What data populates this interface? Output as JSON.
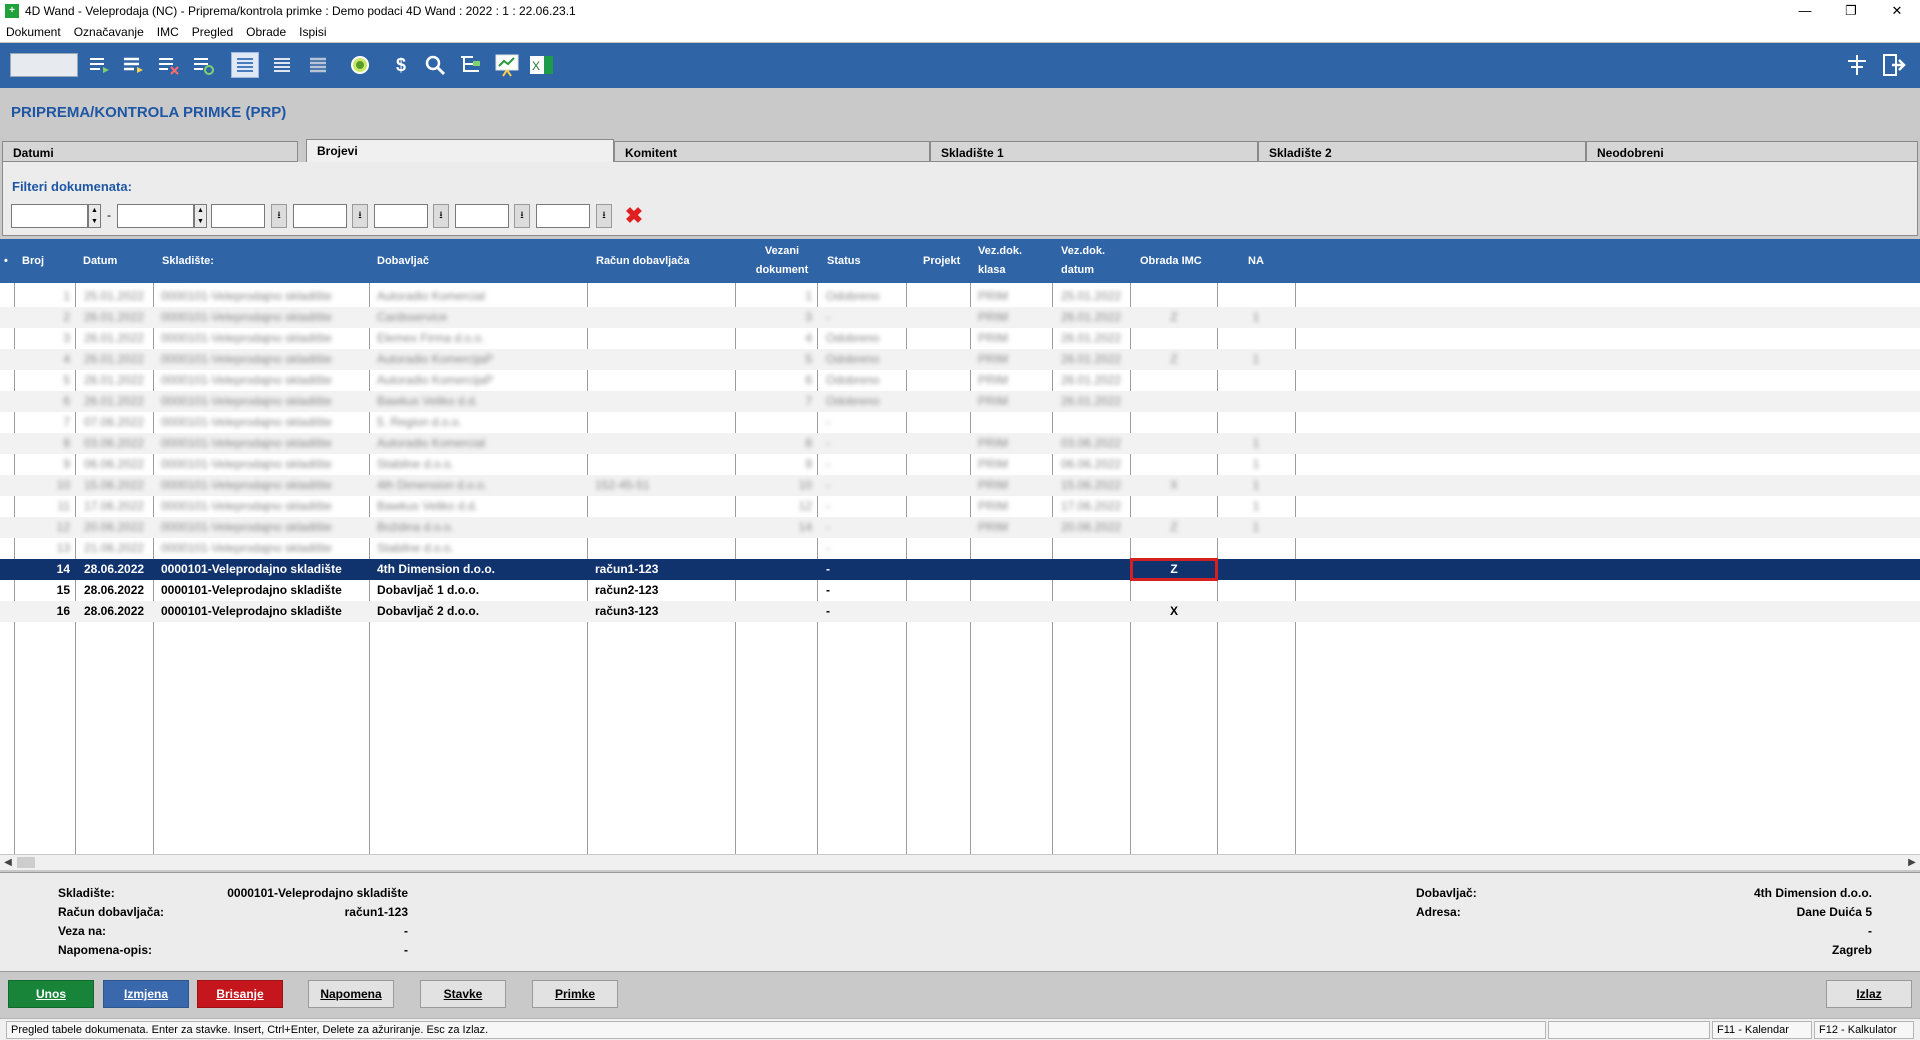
{
  "window": {
    "title": "4D Wand - Veleprodaja (NC) - Priprema/kontrola primke : Demo podaci 4D Wand : 2022 : 1 : 22.06.23.1",
    "controls": [
      "—",
      "❐",
      "✕"
    ]
  },
  "menu": [
    "Dokument",
    "Označavanje",
    "IMC",
    "Pregled",
    "Obrade",
    "Ispisi"
  ],
  "toolbar": {
    "icons": [
      "list-arrow-icon",
      "list-bold-arrow-icon",
      "list-delete-icon",
      "list-refresh-icon",
      "view-rows-icon",
      "view-lines-icon",
      "view-dense-icon",
      "circle-icon",
      "dollar-icon",
      "search-icon",
      "tree-list-icon",
      "chart-board-icon",
      "excel-icon",
      "settings-sliders-icon",
      "exit-icon"
    ]
  },
  "page": {
    "title": "PRIPREMA/KONTROLA PRIMKE (PRP)"
  },
  "tabs": [
    {
      "label": "Datumi",
      "active": false
    },
    {
      "label": "Brojevi",
      "active": true
    },
    {
      "label": "Komitent",
      "active": false
    },
    {
      "label": "Skladište 1",
      "active": false
    },
    {
      "label": "Skladište 2",
      "active": false
    },
    {
      "label": "Neodobreni",
      "active": false
    }
  ],
  "filters": {
    "label": "Filteri dokumenata:",
    "range_separator": "-",
    "clear_icon": "✖"
  },
  "grid": {
    "columns": {
      "marker": "•",
      "broj": "Broj",
      "datum": "Datum",
      "skladiste": "Skladište:",
      "dobavljac": "Dobavljač",
      "racun": "Račun dobavljača",
      "vezani_1": "Vezani",
      "vezani_2": "dokument",
      "status": "Status",
      "projekt": "Projekt",
      "vezklasa_1": "Vez.dok.",
      "vezklasa_2": "klasa",
      "vezdatum_1": "Vez.dok.",
      "vezdatum_2": "datum",
      "obrada": "Obrada IMC",
      "na": "NA"
    },
    "blurred_rows": [
      {
        "broj": "1",
        "datum": "25.01.2022",
        "skladiste": "0000101-Veleprodajno skladište",
        "dobavljac": "Autoradio Komercial",
        "racun": "",
        "vezani": "1",
        "status": "Odobreno",
        "vezklasa": "PRIM",
        "vezdatum": "25.01.2022",
        "obrada": "",
        "na": ""
      },
      {
        "broj": "2",
        "datum": "26.01.2022",
        "skladiste": "0000101-Veleprodajno skladište",
        "dobavljac": "Cardsservice",
        "racun": "",
        "vezani": "3",
        "status": "-",
        "vezklasa": "PRIM",
        "vezdatum": "26.01.2022",
        "obrada": "Z",
        "na": "1"
      },
      {
        "broj": "3",
        "datum": "26.01.2022",
        "skladiste": "0000101-Veleprodajno skladište",
        "dobavljac": "Elemex Firma d.o.o.",
        "racun": "",
        "vezani": "4",
        "status": "Odobreno",
        "vezklasa": "PRIM",
        "vezdatum": "26.01.2022",
        "obrada": "",
        "na": ""
      },
      {
        "broj": "4",
        "datum": "26.01.2022",
        "skladiste": "0000101-Veleprodajno skladište",
        "dobavljac": "Autoradio KomercijaP",
        "racun": "",
        "vezani": "5",
        "status": "Odobreno",
        "vezklasa": "PRIM",
        "vezdatum": "26.01.2022",
        "obrada": "Z",
        "na": "1"
      },
      {
        "broj": "5",
        "datum": "26.01.2022",
        "skladiste": "0000101-Veleprodajno skladište",
        "dobavljac": "Autoradio KomercijaP",
        "racun": "",
        "vezani": "6",
        "status": "Odobreno",
        "vezklasa": "PRIM",
        "vezdatum": "26.01.2022",
        "obrada": "",
        "na": ""
      },
      {
        "broj": "6",
        "datum": "26.01.2022",
        "skladiste": "0000101-Veleprodajno skladište",
        "dobavljac": "Bawkus Veliko d.d.",
        "racun": "",
        "vezani": "7",
        "status": "Odobreno",
        "vezklasa": "PRIM",
        "vezdatum": "26.01.2022",
        "obrada": "",
        "na": ""
      },
      {
        "broj": "7",
        "datum": "07.06.2022",
        "skladiste": "0000101-Veleprodajno skladište",
        "dobavljac": "5. Region d.o.o.",
        "racun": "",
        "vezani": "",
        "status": "-",
        "vezklasa": "",
        "vezdatum": "",
        "obrada": "",
        "na": ""
      },
      {
        "broj": "8",
        "datum": "03.06.2022",
        "skladiste": "0000101-Veleprodajno skladište",
        "dobavljac": "Autoradio Komercial",
        "racun": "",
        "vezani": "8",
        "status": "-",
        "vezklasa": "PRIM",
        "vezdatum": "03.06.2022",
        "obrada": "",
        "na": "1"
      },
      {
        "broj": "9",
        "datum": "06.06.2022",
        "skladiste": "0000101-Veleprodajno skladište",
        "dobavljac": "Stabilne d.o.o.",
        "racun": "",
        "vezani": "9",
        "status": "-",
        "vezklasa": "PRIM",
        "vezdatum": "06.06.2022",
        "obrada": "",
        "na": "1"
      },
      {
        "broj": "10",
        "datum": "15.06.2022",
        "skladiste": "0000101-Veleprodajno skladište",
        "dobavljac": "4th Dimension d.o.o.",
        "racun": "152-45-51",
        "vezani": "10",
        "status": "-",
        "vezklasa": "PRIM",
        "vezdatum": "15.06.2022",
        "obrada": "X",
        "na": "1"
      },
      {
        "broj": "11",
        "datum": "17.06.2022",
        "skladiste": "0000101-Veleprodajno skladište",
        "dobavljac": "Bawkus Veliko d.d.",
        "racun": "",
        "vezani": "12",
        "status": "-",
        "vezklasa": "PRIM",
        "vezdatum": "17.06.2022",
        "obrada": "",
        "na": "1"
      },
      {
        "broj": "12",
        "datum": "20.06.2022",
        "skladiste": "0000101-Veleprodajno skladište",
        "dobavljac": "Boždina d.o.o.",
        "racun": "",
        "vezani": "14",
        "status": "-",
        "vezklasa": "PRIM",
        "vezdatum": "20.06.2022",
        "obrada": "Z",
        "na": "1"
      },
      {
        "broj": "13",
        "datum": "21.06.2022",
        "skladiste": "0000101-Veleprodajno skladište",
        "dobavljac": "Stabilne d.o.o.",
        "racun": "",
        "vezani": "",
        "status": "-",
        "vezklasa": "",
        "vezdatum": "",
        "obrada": "",
        "na": ""
      }
    ],
    "rows": [
      {
        "broj": "14",
        "datum": "28.06.2022",
        "skladiste": "0000101-Veleprodajno skladište",
        "dobavljac": "4th Dimension d.o.o.",
        "racun": "račun1-123",
        "vezani": "",
        "status": "-",
        "projekt": "",
        "vezklasa": "",
        "vezdatum": "",
        "obrada": "Z",
        "na": ""
      },
      {
        "broj": "15",
        "datum": "28.06.2022",
        "skladiste": "0000101-Veleprodajno skladište",
        "dobavljac": "Dobavljač 1 d.o.o.",
        "racun": "račun2-123",
        "vezani": "",
        "status": "-",
        "projekt": "",
        "vezklasa": "",
        "vezdatum": "",
        "obrada": "",
        "na": ""
      },
      {
        "broj": "16",
        "datum": "28.06.2022",
        "skladiste": "0000101-Veleprodajno skladište",
        "dobavljac": "Dobavljač 2  d.o.o.",
        "racun": "račun3-123",
        "vezani": "",
        "status": "-",
        "projekt": "",
        "vezklasa": "",
        "vezdatum": "",
        "obrada": "X",
        "na": ""
      }
    ]
  },
  "details": {
    "skladiste_label": "Skladište:",
    "skladiste_value": "0000101-Veleprodajno skladište",
    "racun_label": "Račun dobavljača:",
    "racun_value": "račun1-123",
    "veza_label": "Veza na:",
    "veza_value": "-",
    "napomena_label": "Napomena-opis:",
    "napomena_value": "-",
    "dobavljac_label": "Dobavljač:",
    "dobavljac_value": "4th Dimension d.o.o.",
    "adresa_label": "Adresa:",
    "adresa_value": "Dane Duića 5",
    "line3_value": "-",
    "grad_value": "Zagreb"
  },
  "buttons": {
    "unos": "Unos",
    "izmjena": "Izmjena",
    "brisanje": "Brisanje",
    "napomena": "Napomena",
    "stavke": "Stavke",
    "primke": "Primke",
    "izlaz": "Izlaz"
  },
  "statusbar": {
    "hint": "Pregled tabele dokumenata. Enter za stavke. Insert, Ctrl+Enter, Delete za ažuriranje. Esc za Izlaz.",
    "empty": "",
    "f11": "F11 - Kalendar",
    "f12": "F12 - Kalkulator"
  },
  "colors": {
    "header_blue": "#2f64a7",
    "selected_row": "#11336d",
    "title_blue": "#1e56a4",
    "unos_green": "#17843a",
    "izmjena_blue": "#3a68ad",
    "brisanje_red": "#c4161c",
    "highlight_red": "#d42020"
  }
}
